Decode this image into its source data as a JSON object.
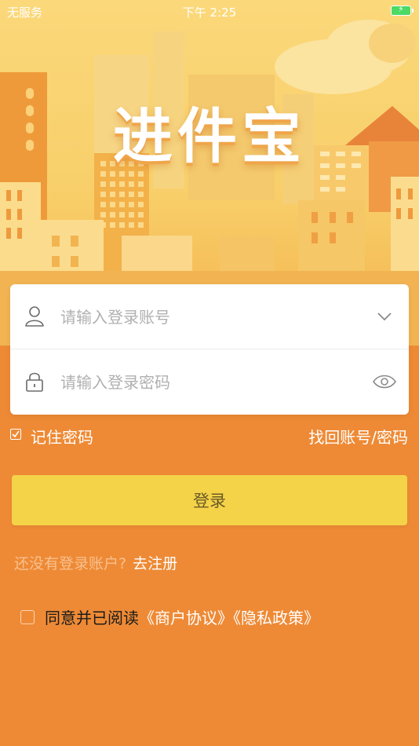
{
  "status_bar": {
    "carrier": "无服务",
    "time": "下午 2:25"
  },
  "app_title": "进件宝",
  "form": {
    "account_placeholder": "请输入登录账号",
    "password_placeholder": "请输入登录密码"
  },
  "options": {
    "remember_label": "记住密码",
    "forgot_label": "找回账号/密码"
  },
  "login_label": "登录",
  "register": {
    "prompt": "还没有登录账户?",
    "link": "去注册"
  },
  "agreement": {
    "prefix": "同意并已阅读",
    "merchant_link": "《商户协议》",
    "privacy_link": "《隐私政策》"
  },
  "icons": {
    "user": "user-icon",
    "lock": "lock-icon",
    "chevron": "chevron-down-icon",
    "eye": "eye-icon",
    "battery": "battery-charging-icon"
  },
  "colors": {
    "background": "#ee8a35",
    "hero_top": "#fbd87a",
    "login_button": "#f4d349",
    "card": "#ffffff"
  }
}
